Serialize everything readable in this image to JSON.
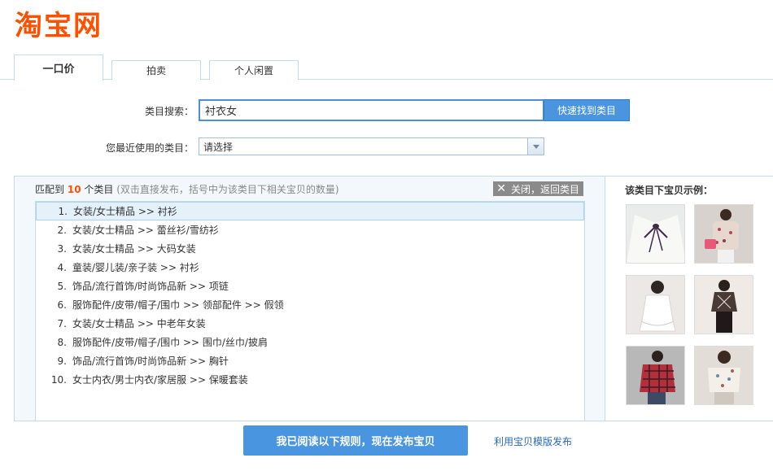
{
  "logo": {
    "text": "淘宝网",
    "color": "#ff5000"
  },
  "tabs": [
    {
      "label": "一口价",
      "active": true
    },
    {
      "label": "拍卖",
      "active": false
    },
    {
      "label": "个人闲置",
      "active": false
    }
  ],
  "search": {
    "label": "类目搜索：",
    "value": "衬衣女",
    "button_label": "快速找到类目"
  },
  "recent": {
    "label": "您最近使用的类目：",
    "selected": "请选择"
  },
  "results": {
    "prefix": "匹配到",
    "count": "10",
    "suffix": "个类目",
    "hint": "(双击直接发布，括号中为该类目下相关宝贝的数量)",
    "close_label": "关闭，返回类目",
    "items": [
      {
        "num": "1.",
        "text": "女装/女士精品 >> 衬衫"
      },
      {
        "num": "2.",
        "text": "女装/女士精品 >> 蕾丝衫/雪纺衫"
      },
      {
        "num": "3.",
        "text": "女装/女士精品 >> 大码女装"
      },
      {
        "num": "4.",
        "text": "童装/婴儿装/亲子装 >> 衬衫"
      },
      {
        "num": "5.",
        "text": "饰品/流行首饰/时尚饰品新 >> 项链"
      },
      {
        "num": "6.",
        "text": "服饰配件/皮带/帽子/围巾 >> 领部配件 >> 假领"
      },
      {
        "num": "7.",
        "text": "女装/女士精品 >> 中老年女装"
      },
      {
        "num": "8.",
        "text": "服饰配件/皮带/帽子/围巾 >> 围巾/丝巾/披肩"
      },
      {
        "num": "9.",
        "text": "饰品/流行首饰/时尚饰品新 >> 胸针"
      },
      {
        "num": "10.",
        "text": "女士内衣/男士内衣/家居服 >> 保暖套装"
      }
    ]
  },
  "samples": {
    "title": "该类目下宝贝示例："
  },
  "footer": {
    "submit_label": "我已阅读以下规则，现在发布宝贝",
    "template_link": "利用宝贝模版发布"
  }
}
